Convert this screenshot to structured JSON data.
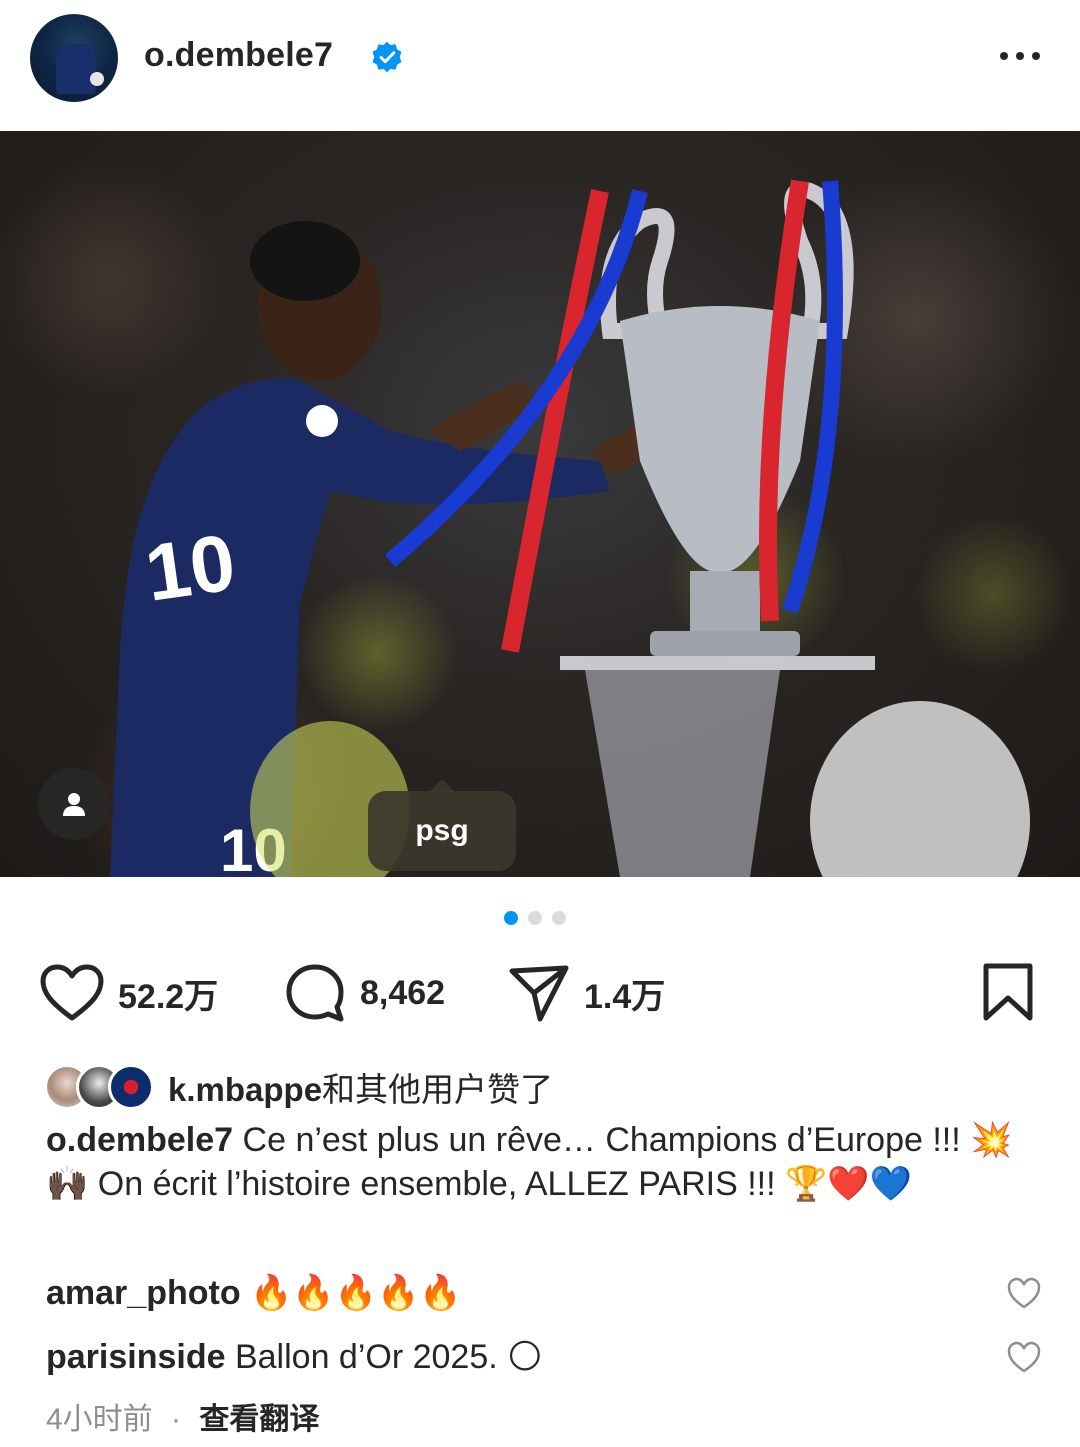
{
  "header": {
    "username": "o.dembele7",
    "verified": true,
    "avatar_icon": "profile-avatar",
    "more_icon": "more-horizontal-icon"
  },
  "photo": {
    "tag_text": "psg",
    "user_tag_icon": "person-icon"
  },
  "carousel": {
    "count": 3,
    "active_index": 0,
    "active_color": "#0095f6"
  },
  "actions": {
    "likes": "52.2万",
    "comments": "8,462",
    "shares": "1.4万"
  },
  "liked_by": {
    "user": "k.mbappe",
    "suffix": "和其他用户赞了"
  },
  "caption": {
    "user": "o.dembele7",
    "text": "Ce n’est plus un rêve… Champions d’Europe !!! 💥🙌🏿 On écrit l’histoire ensemble, ALLEZ PARIS !!! 🏆❤️💙"
  },
  "comments": [
    {
      "user": "amar_photo",
      "text": "🔥🔥🔥🔥🔥"
    },
    {
      "user": "parisinside",
      "text": "Ballon d’Or 2025. 🌕"
    }
  ],
  "meta": {
    "time": "4小时前",
    "separator": "·",
    "translate": "查看翻译"
  }
}
